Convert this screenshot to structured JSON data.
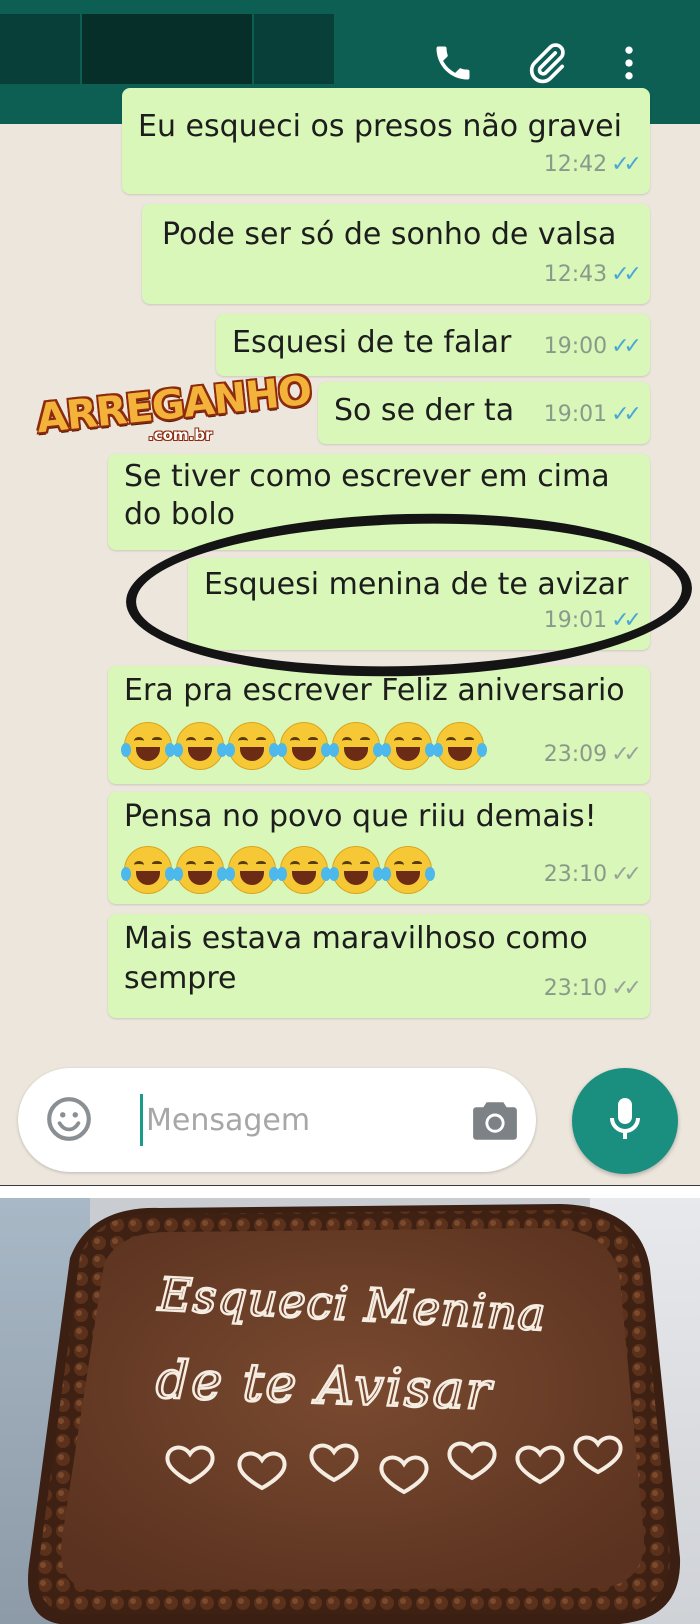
{
  "header": {
    "call_icon": "phone-icon",
    "attach_icon": "paperclip-icon",
    "menu_icon": "more-vertical-icon"
  },
  "messages": [
    {
      "text": "Eu esqueci os presos não gravei",
      "time": "12:42",
      "status": "read"
    },
    {
      "text": "Pode ser só de sonho de valsa",
      "time": "12:43",
      "status": "read"
    },
    {
      "text": "Esquesi de te falar",
      "time": "19:00",
      "status": "read"
    },
    {
      "text": "So se der ta",
      "time": "19:01",
      "status": "read"
    },
    {
      "text_line1": "Se tiver como escrever em cima",
      "text_line2": "do bolo",
      "time": "",
      "status": "read"
    },
    {
      "text": "Esquesi menina de te avizar",
      "time": "19:01",
      "status": "read"
    },
    {
      "text": "Era pra escrever Feliz aniversario",
      "emoji_count": 7,
      "emoji": "face-with-tears-of-joy",
      "time": "23:09",
      "status": "delivered"
    },
    {
      "text": "Pensa no povo que riiu demais!",
      "emoji_count": 6,
      "emoji": "face-with-tears-of-joy",
      "time": "23:10",
      "status": "delivered"
    },
    {
      "text_line1": "Mais estava maravilhoso como",
      "text_line2": "sempre",
      "time": "23:10",
      "status": "delivered"
    }
  ],
  "watermark": {
    "name": "ARREGANHO",
    "domain": ".com.br"
  },
  "composer": {
    "placeholder": "Mensagem",
    "emoji_icon": "smiley-icon",
    "camera_icon": "camera-icon",
    "mic_icon": "microphone-icon"
  },
  "cake": {
    "inscription_line1": "Esqueci Menina",
    "inscription_line2": "de te Avisar",
    "hearts_count": 7
  },
  "colors": {
    "header": "#0d5f54",
    "bubble": "#d8f7b9",
    "chat_bg": "#ece6dc",
    "read_ticks": "#4aa7d6",
    "mic_button": "#1a8f80"
  }
}
